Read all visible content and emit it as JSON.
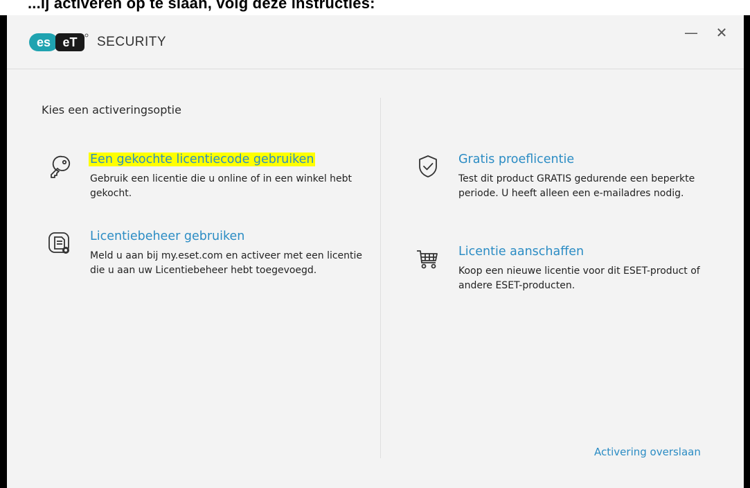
{
  "top_strip": {
    "text": "...ij activeren op te slaan, volg deze instructies:"
  },
  "window": {
    "logo_text": "eset",
    "product_name": "SECURITY",
    "minimize_label": "—",
    "close_label": "✕"
  },
  "main": {
    "heading": "Kies een activeringsoptie",
    "options": [
      {
        "icon": "key-icon",
        "title": "Een gekochte licentiecode gebruiken",
        "highlighted": true,
        "description": "Gebruik een licentie die u online of in een winkel hebt gekocht."
      },
      {
        "icon": "license-manager-icon",
        "title": "Licentiebeheer gebruiken",
        "highlighted": false,
        "description": "Meld u aan bij my.eset.com en activeer met een licentie die u aan uw Licentiebeheer hebt toegevoegd."
      },
      {
        "icon": "shield-check-icon",
        "title": "Gratis proeflicentie",
        "highlighted": false,
        "description": "Test dit product GRATIS gedurende een beperkte periode. U heeft alleen een e-mailadres nodig."
      },
      {
        "icon": "shopping-cart-icon",
        "title": "Licentie aanschaffen",
        "highlighted": false,
        "description": "Koop een nieuwe licentie voor dit ESET-product of andere ESET-producten."
      }
    ],
    "skip_link": "Activering overslaan"
  },
  "colors": {
    "accent": "#2b8cc4",
    "highlight": "#ffff00",
    "background": "#f3f3f3",
    "logo_teal": "#1fa3b0"
  }
}
